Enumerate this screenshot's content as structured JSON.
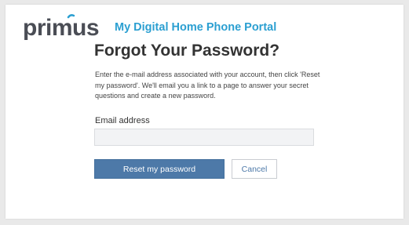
{
  "brand": {
    "logo_text": "primus",
    "logo_icon": "primus-logo-icon",
    "logo_color": "#4a4d55",
    "accent_color": "#2b9fd1"
  },
  "header": {
    "portal_title": "My Digital Home Phone Portal"
  },
  "page": {
    "title": "Forgot Your Password?",
    "intro": "Enter the e-mail address associated with your account, then click 'Reset my password'. We'll email you a link to a page to answer your secret questions and create a new password."
  },
  "form": {
    "email_label": "Email address",
    "email_value": "",
    "reset_label": "Reset my password",
    "cancel_label": "Cancel"
  },
  "colors": {
    "button_primary": "#4d79a8",
    "input_background": "#f2f3f5"
  }
}
